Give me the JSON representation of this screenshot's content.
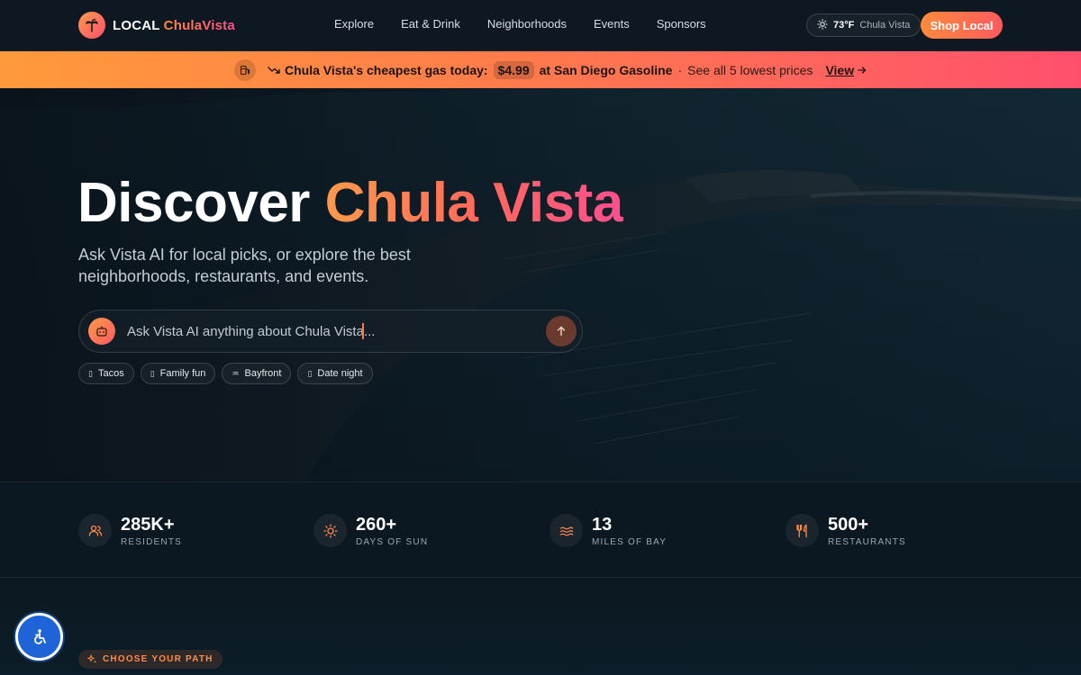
{
  "brand": {
    "local": "LOCAL",
    "city": "ChulaVista",
    "icon": "palm-tree-icon"
  },
  "nav": {
    "links": [
      "Explore",
      "Eat & Drink",
      "Neighborhoods",
      "Events",
      "Sponsors"
    ],
    "weather": {
      "icon": "sun-icon",
      "temp": "73°F",
      "city": "Chula Vista"
    },
    "cta": "Shop Local"
  },
  "banner": {
    "lead": "Chula Vista's cheapest gas today:",
    "price": "$4.99",
    "station": "at San Diego Gasoline",
    "separator": "·",
    "link": "See all 5 lowest prices",
    "view": "View"
  },
  "hero": {
    "title_plain": "Discover",
    "title_accent": "Chula Vista",
    "subtitle": "Ask Vista AI for local picks, or explore the best neighborhoods, restaurants, and events.",
    "search_placeholder": "Ask Vista AI anything about Chula Vista...",
    "chips": [
      {
        "label": "Tacos",
        "icon": "taco-icon"
      },
      {
        "label": "Family fun",
        "icon": "family-icon"
      },
      {
        "label": "Bayfront",
        "icon": "wave-icon"
      },
      {
        "label": "Date night",
        "icon": "heart-icon"
      }
    ]
  },
  "stats": [
    {
      "value": "285K+",
      "label": "RESIDENTS",
      "icon": "users-icon"
    },
    {
      "value": "260+",
      "label": "DAYS OF SUN",
      "icon": "sun-icon"
    },
    {
      "value": "13",
      "label": "MILES OF BAY",
      "icon": "waves-icon"
    },
    {
      "value": "500+",
      "label": "RESTAURANTS",
      "icon": "utensils-icon"
    }
  ],
  "section": {
    "eyebrow": "CHOOSE YOUR PATH",
    "icon": "sparkle-icon"
  },
  "colors": {
    "accent_orange": "#ff8a3d",
    "accent_pink": "#ff4f8a",
    "accessibility_blue": "#1f63d9"
  }
}
